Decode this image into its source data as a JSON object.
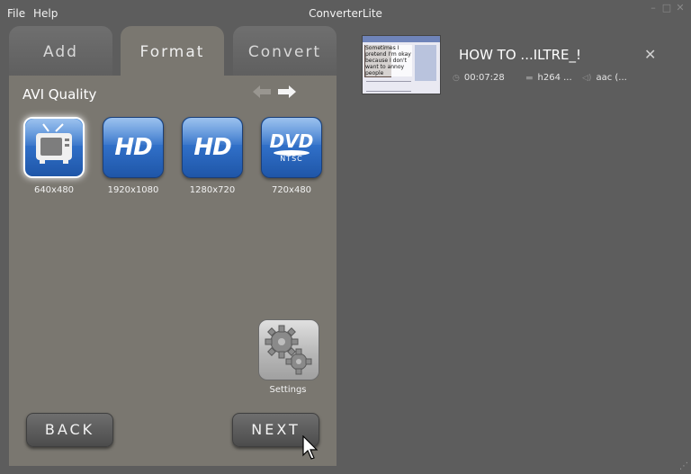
{
  "window": {
    "title": "ConverterLite",
    "menu": [
      "File",
      "Help"
    ]
  },
  "tabs": [
    {
      "label": "Add",
      "active": false
    },
    {
      "label": "Format",
      "active": true
    },
    {
      "label": "Convert",
      "active": false
    }
  ],
  "quality": {
    "label": "AVI Quality"
  },
  "presets": [
    {
      "label": "640x480",
      "icon": "tv-icon",
      "selected": true
    },
    {
      "label": "1920x1080",
      "icon": "hd-icon",
      "badge": "HD",
      "selected": false
    },
    {
      "label": "1280x720",
      "icon": "hd-icon",
      "badge": "HD",
      "selected": false
    },
    {
      "label": "720x480",
      "icon": "dvd-video-icon",
      "badge": "DVD",
      "sub": "NTSC",
      "selected": false
    }
  ],
  "settings": {
    "label": "Settings"
  },
  "buttons": {
    "back": "BACK",
    "next": "NEXT"
  },
  "file_item": {
    "title": "HOW TO ...ILTRE_!",
    "duration": "00:07:28",
    "video_codec": "h264 ...",
    "audio_codec": "aac (...",
    "thumbnail_text": "Sometimes I pretend I'm okay because I don't want to annoy people"
  },
  "colors": {
    "background": "#5d5d5d",
    "panel": "#7a7770",
    "accent_blue": "#2f6ec6"
  }
}
